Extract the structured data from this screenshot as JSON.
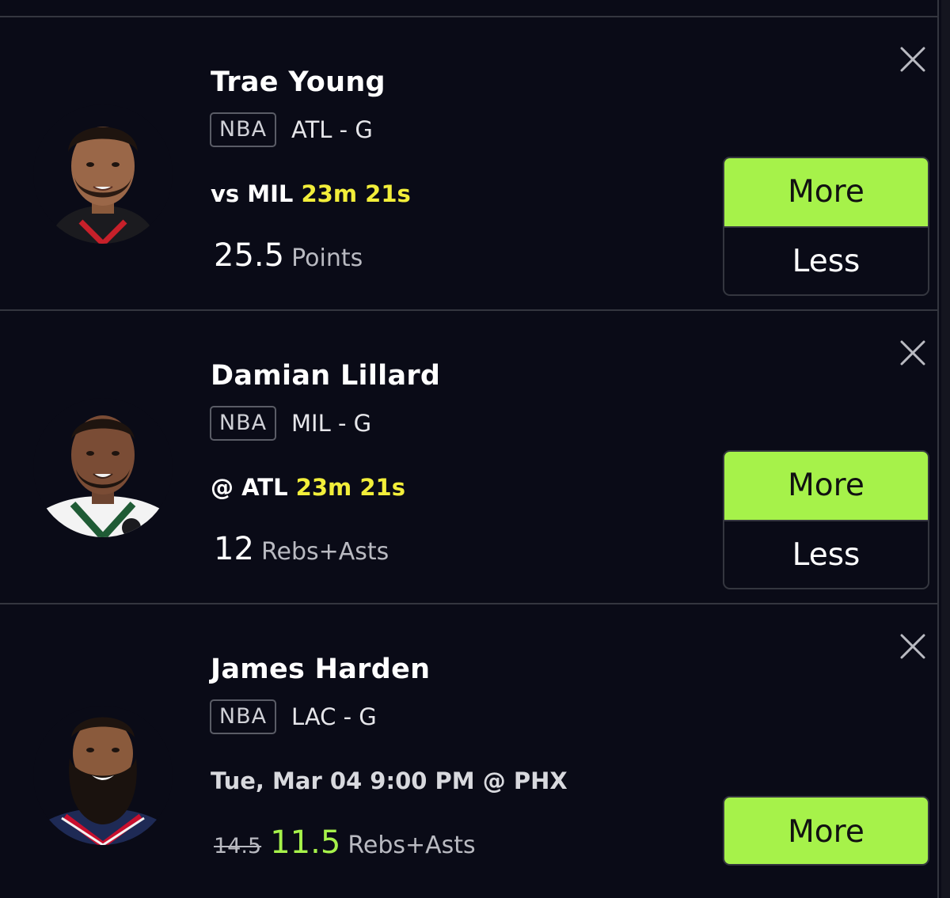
{
  "colors": {
    "background": "#0a0b17",
    "accent_green": "#a6f24a",
    "countdown_yellow": "#f2ee3a",
    "divider": "#34363f"
  },
  "icons": {
    "close": "close-icon",
    "avatar": "player-avatar"
  },
  "picks": [
    {
      "player_name": "Trae Young",
      "league": "NBA",
      "team_position": "ATL - G",
      "matchup": "vs MIL",
      "countdown": "23m 21s",
      "line": "25.5",
      "stat": "Points",
      "more_label": "More",
      "less_label": "Less"
    },
    {
      "player_name": "Damian Lillard",
      "league": "NBA",
      "team_position": "MIL - G",
      "matchup": "@ ATL",
      "countdown": "23m 21s",
      "line": "12",
      "stat": "Rebs+Asts",
      "more_label": "More",
      "less_label": "Less"
    },
    {
      "player_name": "James Harden",
      "league": "NBA",
      "team_position": "LAC - G",
      "game_time": "Tue, Mar 04 9:00 PM @ PHX",
      "original_line": "14.5",
      "line": "11.5",
      "stat": "Rebs+Asts",
      "more_label": "More"
    }
  ]
}
